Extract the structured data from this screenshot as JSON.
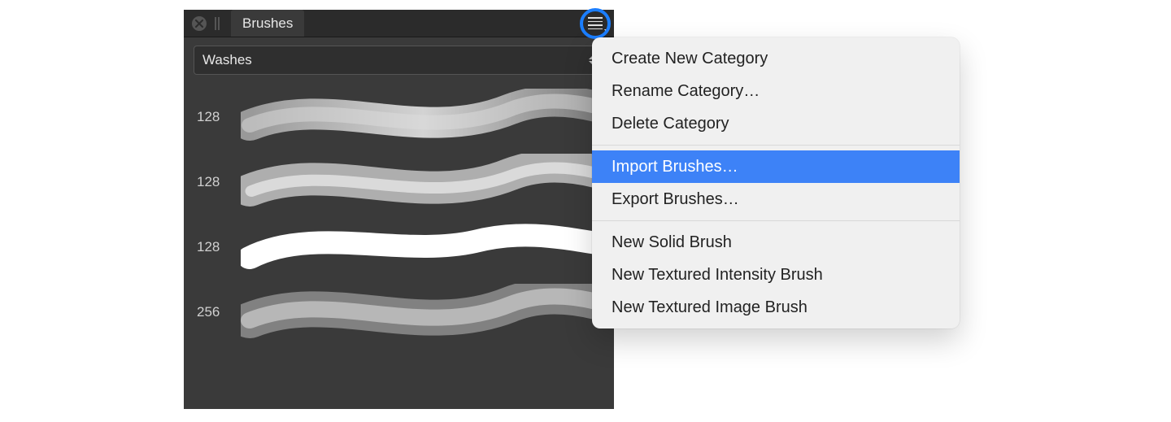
{
  "panel": {
    "tab_label": "Brushes",
    "category_selected": "Washes",
    "brushes": [
      {
        "size": "128"
      },
      {
        "size": "128"
      },
      {
        "size": "128"
      },
      {
        "size": "256"
      }
    ]
  },
  "menu": {
    "groups": [
      {
        "items": [
          "Create New Category",
          "Rename Category…",
          "Delete Category"
        ]
      },
      {
        "items": [
          "Import Brushes…",
          "Export Brushes…"
        ],
        "highlighted_index": 0
      },
      {
        "items": [
          "New Solid Brush",
          "New Textured Intensity Brush",
          "New Textured Image Brush"
        ]
      }
    ]
  },
  "colors": {
    "accent": "#3d82f7",
    "highlight_ring": "#1b7eff",
    "panel_bg": "#3a3a3a"
  }
}
